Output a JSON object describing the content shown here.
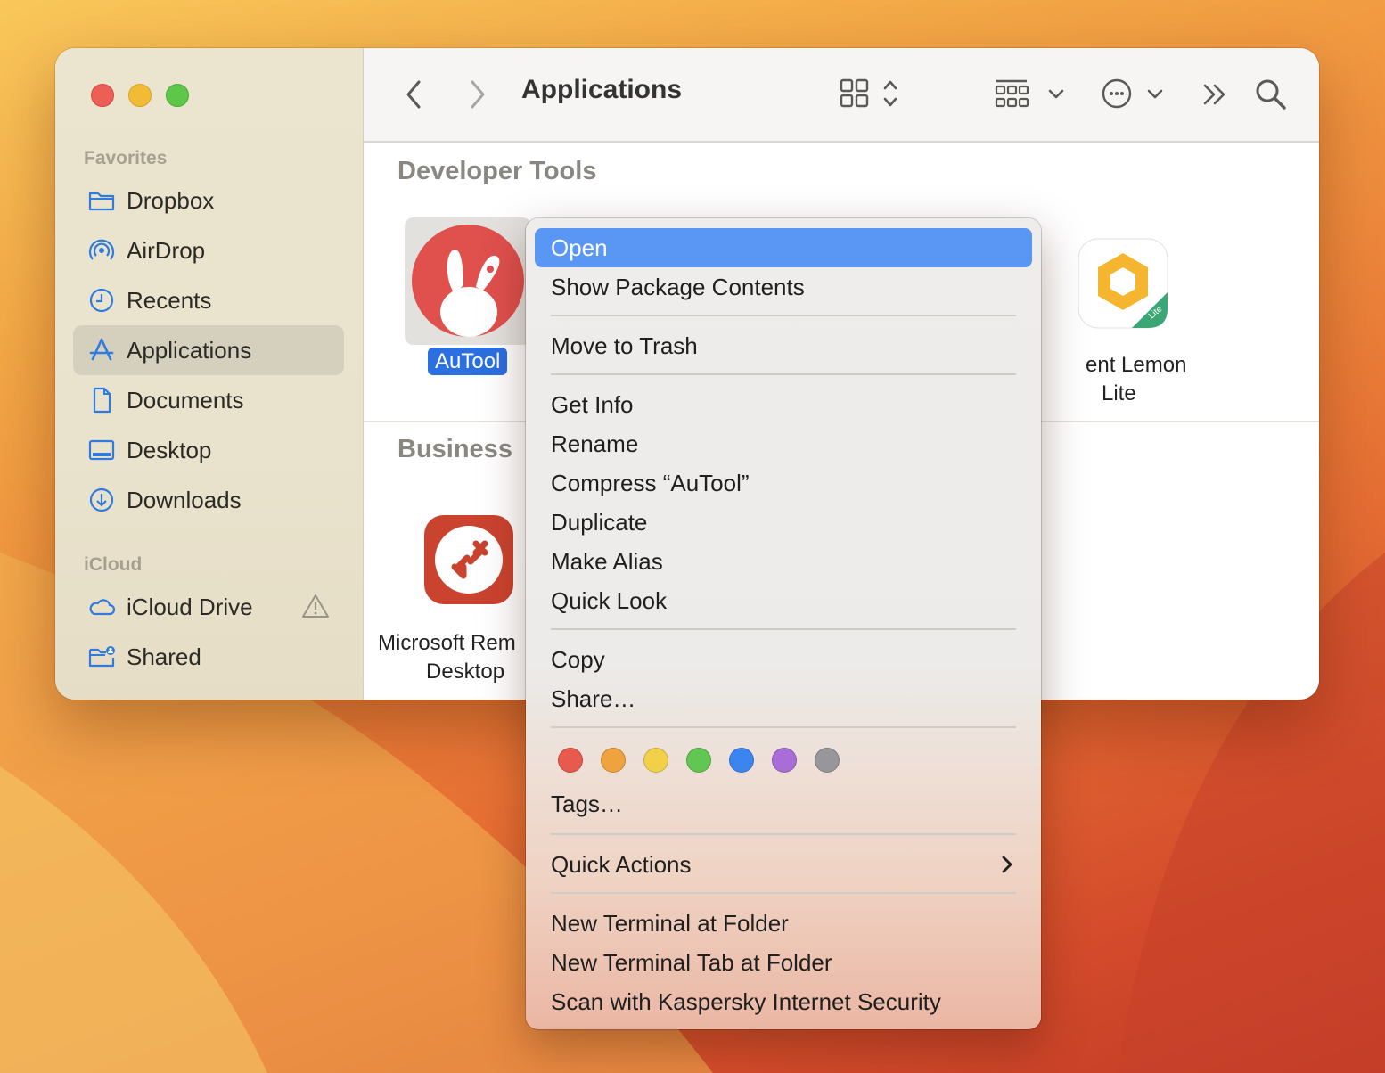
{
  "window": {
    "title": "Applications"
  },
  "sidebar": {
    "favorites_header": "Favorites",
    "icloud_header": "iCloud",
    "favorites": [
      {
        "label": "Dropbox",
        "icon": "folder-icon"
      },
      {
        "label": "AirDrop",
        "icon": "airdrop-icon"
      },
      {
        "label": "Recents",
        "icon": "clock-icon"
      },
      {
        "label": "Applications",
        "icon": "applications-icon",
        "selected": true
      },
      {
        "label": "Documents",
        "icon": "document-icon"
      },
      {
        "label": "Desktop",
        "icon": "desktop-icon"
      },
      {
        "label": "Downloads",
        "icon": "download-icon"
      }
    ],
    "icloud": [
      {
        "label": "iCloud Drive",
        "icon": "cloud-icon",
        "warning_icon": "warning-icon"
      },
      {
        "label": "Shared",
        "icon": "shared-folder-icon"
      }
    ]
  },
  "content": {
    "groups": [
      {
        "name": "Developer Tools",
        "apps": [
          {
            "name": "AuTool",
            "selected": true
          },
          {
            "name_line1": "ent Lemon",
            "name_line2": "Lite"
          }
        ]
      },
      {
        "name": "Business",
        "apps": [
          {
            "name_line1": "Microsoft Rem",
            "name_line2": "Desktop"
          }
        ]
      }
    ]
  },
  "context_menu": {
    "items": {
      "open": "Open",
      "show_package": "Show Package Contents",
      "move_trash": "Move to Trash",
      "get_info": "Get Info",
      "rename": "Rename",
      "compress": "Compress “AuTool”",
      "duplicate": "Duplicate",
      "make_alias": "Make Alias",
      "quick_look": "Quick Look",
      "copy": "Copy",
      "share": "Share…",
      "tags": "Tags…",
      "quick_actions": "Quick Actions",
      "new_terminal": "New Terminal at Folder",
      "new_terminal_tab": "New Terminal Tab at Folder",
      "scan_kaspersky": "Scan with Kaspersky Internet Security"
    },
    "highlighted": "open",
    "tag_colors": [
      "#e8594e",
      "#eea33f",
      "#f3d04a",
      "#62c655",
      "#3b86ee",
      "#a86dd6",
      "#97969a"
    ]
  },
  "colors": {
    "accent": "#2b6fe0",
    "menu_highlight": "#5a97f5"
  }
}
